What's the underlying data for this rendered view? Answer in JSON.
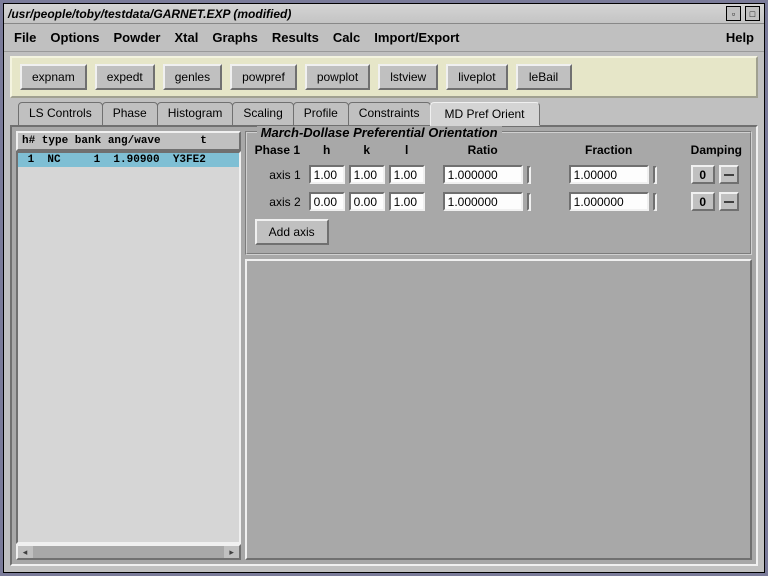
{
  "window": {
    "title": "/usr/people/toby/testdata/GARNET.EXP (modified)"
  },
  "menus": [
    "File",
    "Options",
    "Powder",
    "Xtal",
    "Graphs",
    "Results",
    "Calc",
    "Import/Export"
  ],
  "menuRight": "Help",
  "toolbar": [
    "expnam",
    "expedt",
    "genles",
    "powpref",
    "powplot",
    "lstview",
    "liveplot",
    "leBail"
  ],
  "tabs": [
    "LS Controls",
    "Phase",
    "Histogram",
    "Scaling",
    "Profile",
    "Constraints",
    "MD Pref Orient"
  ],
  "activeTab": 6,
  "table": {
    "header": "h# type bank ang/wave      t",
    "rows": [
      {
        "text": " 1  NC     1  1.90900  Y3FE2",
        "selected": true
      }
    ]
  },
  "group": {
    "title": "March-Dollase Preferential Orientation",
    "headers": {
      "phase": "Phase 1",
      "h": "h",
      "k": "k",
      "l": "l",
      "ratio": "Ratio",
      "fraction": "Fraction",
      "damping": "Damping"
    },
    "axes": [
      {
        "label": "axis 1",
        "h": "1.00",
        "k": "1.00",
        "l": "1.00",
        "ratio": "1.000000",
        "fraction": "1.00000",
        "damp": "0"
      },
      {
        "label": "axis 2",
        "h": "0.00",
        "k": "0.00",
        "l": "1.00",
        "ratio": "1.000000",
        "fraction": "1.000000",
        "damp": "0"
      }
    ],
    "addLabel": "Add axis"
  }
}
